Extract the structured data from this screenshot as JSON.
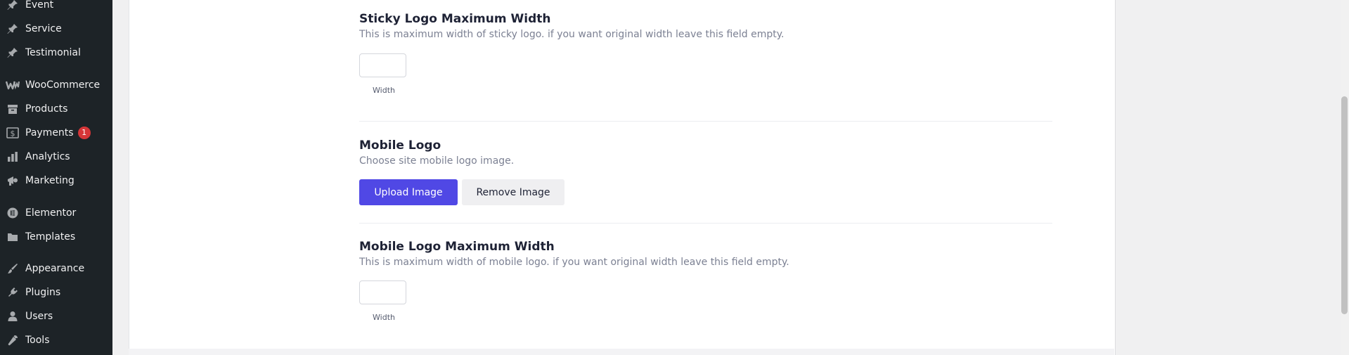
{
  "sidebar": {
    "items": [
      {
        "label": "Event",
        "icon": "pin-icon"
      },
      {
        "label": "Service",
        "icon": "pin-icon"
      },
      {
        "label": "Testimonial",
        "icon": "pin-icon"
      },
      {
        "label": "WooCommerce",
        "icon": "woocommerce-icon"
      },
      {
        "label": "Products",
        "icon": "archive-icon"
      },
      {
        "label": "Payments",
        "icon": "dollar-icon",
        "badge": "1"
      },
      {
        "label": "Analytics",
        "icon": "bar-chart-icon"
      },
      {
        "label": "Marketing",
        "icon": "megaphone-icon"
      },
      {
        "label": "Elementor",
        "icon": "elementor-icon"
      },
      {
        "label": "Templates",
        "icon": "folder-icon"
      },
      {
        "label": "Appearance",
        "icon": "brush-icon"
      },
      {
        "label": "Plugins",
        "icon": "plug-icon"
      },
      {
        "label": "Users",
        "icon": "user-icon"
      },
      {
        "label": "Tools",
        "icon": "wrench-icon"
      }
    ]
  },
  "sections": {
    "sticky_logo_width": {
      "title": "Sticky Logo Maximum Width",
      "description": "This is maximum width of sticky logo. if you want original width leave this field empty.",
      "input_label": "Width",
      "value": ""
    },
    "mobile_logo": {
      "title": "Mobile Logo",
      "description": "Choose site mobile logo image.",
      "upload_label": "Upload Image",
      "remove_label": "Remove Image"
    },
    "mobile_logo_width": {
      "title": "Mobile Logo Maximum Width",
      "description": "This is maximum width of mobile logo. if you want original width leave this field empty.",
      "input_label": "Width",
      "value": ""
    }
  },
  "colors": {
    "sidebar_bg": "#1d2327",
    "primary_button": "#5048e5",
    "badge": "#d63638"
  }
}
